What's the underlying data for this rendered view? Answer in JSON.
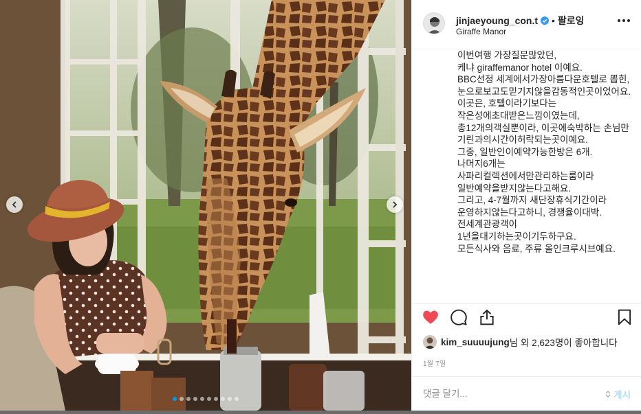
{
  "post": {
    "username": "jinjaeyoung_con.t",
    "separator": "•",
    "follow_label": "팔로잉",
    "location": "Giraffe Manor",
    "caption": "이번여행 가장질문많았던,\n케냐 giraffemanor hotel 이예요.\nBBC선정 세계에서가장아름다운호텔로 뽑힌,\n눈으로보고도믿기지않을감동적인곳이었어요.\n이곳은, 호텔이라기보다는 작은성에초대받은느낌이였는데,\n총12개의객실뿐이라, 이곳에숙박하는 손님만 기린과의시간이허락되는곳이예요.\n그중, 일반인이예약가능한방은 6개.\n나머지6개는 사파리컬렉션에서만관리하는룸이라\n일반예약을받지않는다고해요.\n그리고, 4-7월까지 새단장휴식기간이라 운영하지않는다고하니, 경쟁율이대박. 전세계관광객이 1년을대기하는곳이기두하구요.\n모든식사와 음료, 주류 올인크루시브예요.",
    "likes_user": "kim_suuuujung",
    "likes_suffix": "님 외 2,623명이 좋아합니다",
    "date": "1월 7일",
    "comment_placeholder": "댓글 달기...",
    "post_button": "게시"
  },
  "carousel": {
    "total_slides": 10,
    "active_index": 0
  },
  "icons": {
    "like": "heart-icon-filled",
    "comment": "comment-icon",
    "share": "share-icon",
    "save": "bookmark-icon",
    "verified": "verified-badge-icon",
    "more": "more-options-icon",
    "prev": "chevron-left-icon",
    "next": "chevron-right-icon"
  },
  "colors": {
    "like_red": "#ed4956",
    "verified_blue": "#3897f0",
    "post_button_disabled": "#b2dffc",
    "border": "#efefef",
    "secondary_text": "#8e8e8e"
  }
}
